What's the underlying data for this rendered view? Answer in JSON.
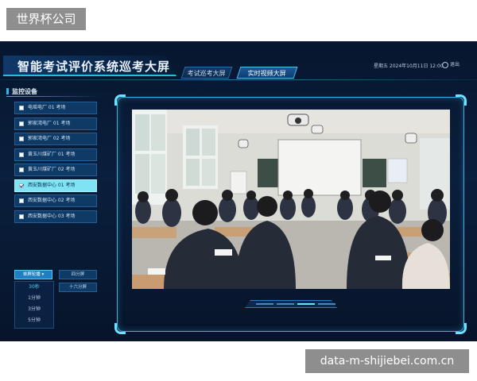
{
  "corp_tag": "世界杯公司",
  "header": {
    "title": "智能考试评价系统巡考大屏",
    "tabs": [
      {
        "label": "考试巡考大屏",
        "active": false
      },
      {
        "label": "实时视频大屏",
        "active": true
      }
    ],
    "datetime": "星期五  2024年10月11日  12:00",
    "exit_label": "退出"
  },
  "left_panel": {
    "title": "监控设备",
    "devices": [
      {
        "label": "电瑶电厂 01 考场",
        "checked": false
      },
      {
        "label": "郭家湾电厂 01 考场",
        "checked": false
      },
      {
        "label": "郭家湾电厂 02 考场",
        "checked": false
      },
      {
        "label": "黄玉川煤矿厂 01 考场",
        "checked": false
      },
      {
        "label": "黄玉川煤矿厂 02 考场",
        "checked": false
      },
      {
        "label": "西安数据中心 01 考场",
        "checked": true
      },
      {
        "label": "西安数据中心 02 考场",
        "checked": false
      },
      {
        "label": "西安数据中心 03 考场",
        "checked": false
      }
    ],
    "buttons": {
      "rotate": "单屏轮播 ▾",
      "quad": "四分屏",
      "sixteen": "十六分屏"
    },
    "intervals": [
      "30秒",
      "1分钟",
      "3分钟",
      "5分钟"
    ],
    "selected_interval": "30秒"
  },
  "video": {
    "pager_count": 4,
    "active_page": 3
  },
  "watermark": "data-m-shijiebei.com.cn",
  "colors": {
    "accent": "#2bb8e6",
    "selected_item": "#7fe3f3",
    "background": "#07162e"
  }
}
